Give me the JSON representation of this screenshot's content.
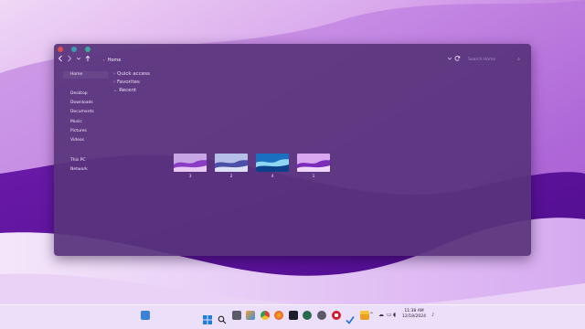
{
  "colors": {
    "accent": "#7a3aa8",
    "window_bg": "#58347c",
    "close": "#e0504a",
    "minimize": "#3a9bb0",
    "maximize": "#3aa89a"
  },
  "toolbar": {
    "back_icon": "chevron-left-icon",
    "forward_icon": "chevron-right-icon",
    "history_icon": "chevron-down-icon",
    "up_icon": "arrow-up-icon",
    "location_icon": "chevron-right-icon",
    "location": "Home",
    "dropdown_icon": "chevron-down-icon",
    "refresh_icon": "refresh-icon",
    "search_placeholder": "Search Home",
    "search_icon": "search-icon"
  },
  "sidebar": {
    "items": [
      {
        "label": "Home",
        "active": true
      },
      {
        "label": "Desktop"
      },
      {
        "label": "Downloads"
      },
      {
        "label": "Documents"
      },
      {
        "label": "Music"
      },
      {
        "label": "Pictures"
      },
      {
        "label": "Videos"
      },
      {
        "label": "This PC"
      },
      {
        "label": "Network"
      }
    ]
  },
  "main": {
    "groups": [
      {
        "label": "Quick access",
        "expanded": false
      },
      {
        "label": "Favorites",
        "expanded": false
      },
      {
        "label": "Recent",
        "expanded": true
      }
    ],
    "files": [
      {
        "name": "3",
        "palette": [
          "#c8a6e6",
          "#8a3cc4",
          "#e6c8f2"
        ]
      },
      {
        "name": "2",
        "palette": [
          "#b6bfe8",
          "#4a4fa8",
          "#dcdff6"
        ]
      },
      {
        "name": "4",
        "palette": [
          "#8fd6f2",
          "#1a6fc0",
          "#c0ecfa"
        ]
      },
      {
        "name": "1",
        "palette": [
          "#d9a6f0",
          "#7c2ab8",
          "#f0d6fa"
        ]
      }
    ]
  },
  "taskbar": {
    "icons": [
      "widgets-icon",
      "start-icon",
      "search-icon",
      "task-view-icon",
      "store-icon",
      "chrome-icon",
      "firefox-icon",
      "terminal-icon",
      "clock-app-icon",
      "settings-icon",
      "opera-icon",
      "check-icon",
      "file-explorer-icon"
    ],
    "tray_icons": [
      "chevron-up-icon",
      "cloud-icon",
      "monitor-icon",
      "volume-icon",
      "globe-icon",
      "battery-icon"
    ],
    "time": "11:38 AM",
    "date": "12/18/2024",
    "notification_icon": "bell-icon"
  }
}
